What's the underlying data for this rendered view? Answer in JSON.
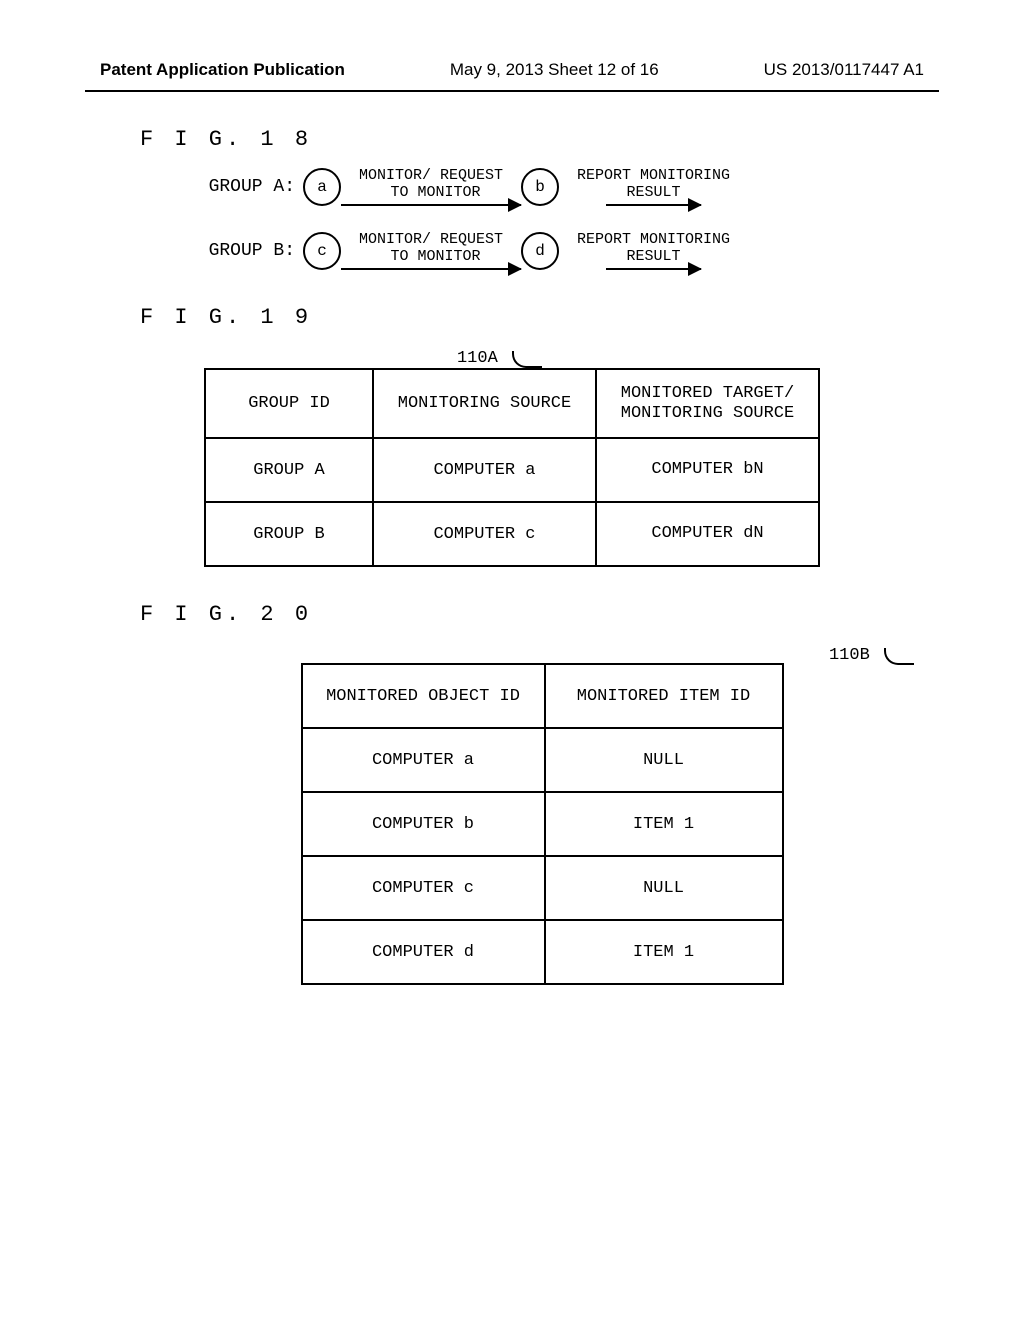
{
  "header": {
    "left": "Patent Application Publication",
    "mid": "May 9, 2013  Sheet 12 of 16",
    "right": "US 2013/0117447 A1"
  },
  "fig18": {
    "label": "F I G.  1 8",
    "rows": [
      {
        "group": "GROUP A:",
        "node1": "a",
        "arrow1": "MONITOR/ REQUEST\n TO MONITOR",
        "node2": "b",
        "arrow2": "REPORT MONITORING\nRESULT"
      },
      {
        "group": "GROUP B:",
        "node1": "c",
        "arrow1": "MONITOR/ REQUEST\n TO MONITOR",
        "node2": "d",
        "arrow2": "REPORT MONITORING\nRESULT"
      }
    ]
  },
  "fig19": {
    "label": "F I G.  1 9",
    "ref": "110A",
    "headers": [
      "GROUP ID",
      "MONITORING SOURCE",
      "MONITORED TARGET/\nMONITORING SOURCE"
    ],
    "rows": [
      [
        "GROUP A",
        "COMPUTER a",
        "COMPUTER bN"
      ],
      [
        "GROUP B",
        "COMPUTER c",
        "COMPUTER dN"
      ]
    ]
  },
  "fig20": {
    "label": "F I G.  2 0",
    "ref": "110B",
    "headers": [
      "MONITORED OBJECT ID",
      "MONITORED ITEM ID"
    ],
    "rows": [
      [
        "COMPUTER a",
        "NULL"
      ],
      [
        "COMPUTER b",
        "ITEM 1"
      ],
      [
        "COMPUTER c",
        "NULL"
      ],
      [
        "COMPUTER d",
        "ITEM 1"
      ]
    ]
  }
}
